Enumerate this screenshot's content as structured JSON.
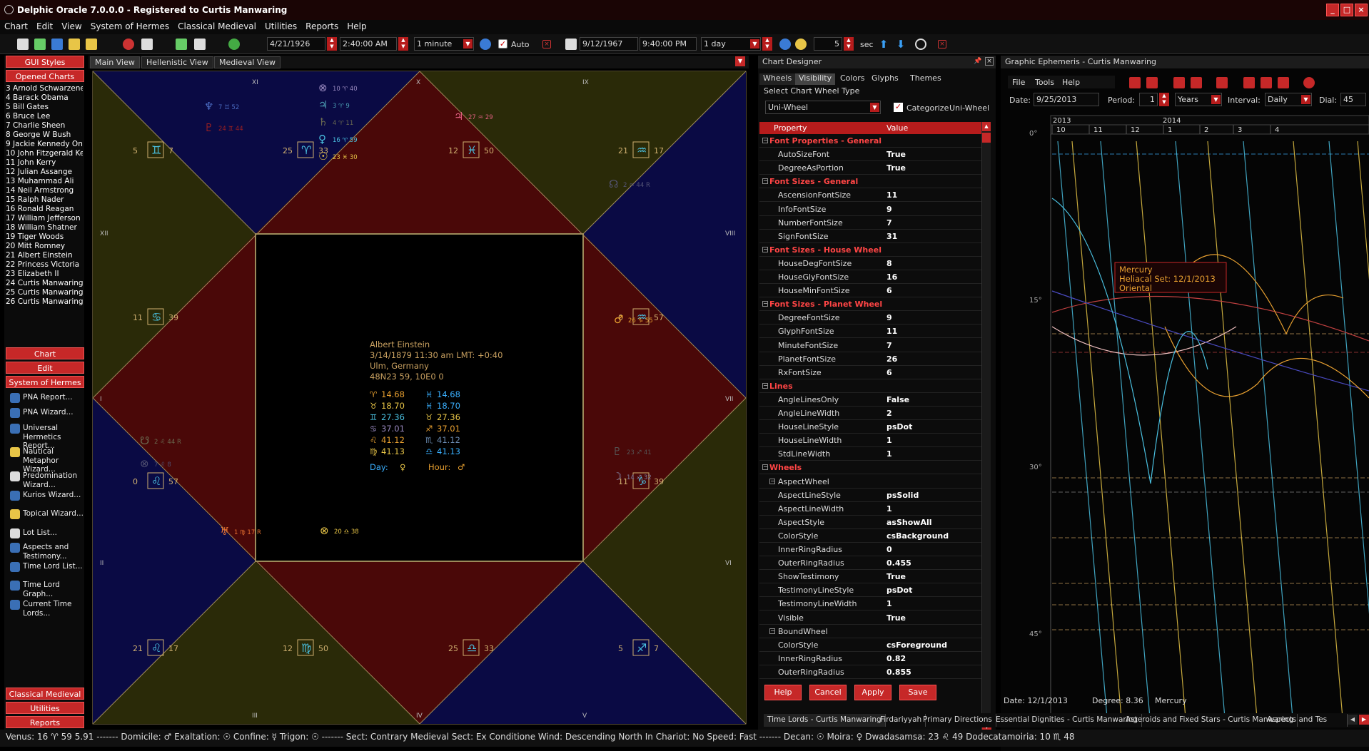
{
  "titlebar": {
    "title": "Delphic Oracle 7.0.0.0 -  Registered to Curtis Manwaring"
  },
  "menu": [
    "Chart",
    "Edit",
    "View",
    "System of Hermes",
    "Classical Medieval",
    "Utilities",
    "Reports",
    "Help"
  ],
  "toolbar": {
    "date1": "4/21/1926",
    "time1": "2:40:00 AM",
    "step1": "1 minute",
    "auto_label": "Auto",
    "date2": "9/12/1967",
    "time2": "9:40:00 PM",
    "step2": "1 day",
    "count": "5",
    "sec_label": "sec"
  },
  "left": {
    "gui_styles": "GUI Styles",
    "opened_charts": "Opened Charts",
    "charts": [
      "3 Arnold Schwarzeneg",
      "4 Barack Obama",
      "5 Bill Gates",
      "6 Bruce Lee",
      "7 Charlie Sheen",
      "8 George W Bush",
      "9 Jackie Kennedy Ona",
      "10 John Fitzgerald Ker",
      "11 John Kerry",
      "12 Julian Assange",
      "13 Muhammad Ali",
      "14 Neil Armstrong",
      "15 Ralph Nader",
      "16 Ronald Reagan",
      "17 William Jefferson C",
      "18 William Shatner",
      "19 Tiger Woods",
      "20 Mitt Romney",
      "21 Albert Einstein",
      "22 Princess Victoria",
      "23 Elizabeth II",
      "24 Curtis Manwaring",
      "25 Curtis Manwaring L",
      "26 Curtis Manwaring L"
    ],
    "sec_chart": "Chart",
    "sec_edit": "Edit",
    "sec_hermes": "System of Hermes",
    "wizards": [
      "PNA Report...",
      "PNA Wizard...",
      "Universal Hermetics Report...",
      "Nautical Metaphor Wizard...",
      "Predomination Wizard...",
      "Kurios Wizard...",
      "Topical Wizard...",
      "Lot List...",
      "Aspects and Testimony...",
      "Time Lord List...",
      "Time Lord Graph...",
      "Current Time Lords..."
    ],
    "classical": "Classical Medieval",
    "utilities": "Utilities",
    "reports": "Reports"
  },
  "view_tabs": [
    "Main View",
    "Hellenistic View",
    "Medieval View"
  ],
  "chart": {
    "center": {
      "name": "Albert Einstein",
      "dateline": "3/14/1879  11:30 am  LMT: +0:40",
      "place": "Ulm, Germany",
      "coords": "48N23 59,  10E0 0",
      "lots": [
        [
          "♈",
          "14.68",
          "♓",
          "14.68"
        ],
        [
          "♉",
          "18.70",
          "♓",
          "18.70"
        ],
        [
          "♊",
          "27.36",
          "♉",
          "27.36"
        ],
        [
          "♋",
          "37.01",
          "♐",
          "37.01"
        ],
        [
          "♌",
          "41.12",
          "♏",
          "41.12"
        ],
        [
          "♍",
          "41.13",
          "♎",
          "41.13"
        ]
      ],
      "day_label": "Day:",
      "day_val": "♀",
      "hour_label": "Hour:",
      "hour_val": "♂"
    },
    "roman": [
      "XI",
      "X",
      "IX",
      "XII",
      "VIII",
      "I",
      "VII",
      "II",
      "VI",
      "III",
      "IV",
      "V"
    ],
    "cusps": [
      [
        "5",
        "♊",
        "7"
      ],
      [
        "25",
        "♈",
        "33"
      ],
      [
        "12",
        "♓",
        "50"
      ],
      [
        "21",
        "♒",
        "17"
      ],
      [
        "11",
        "♋",
        "39"
      ],
      [
        "0",
        "♒",
        "57"
      ],
      [
        "0",
        "♌",
        "57"
      ],
      [
        "11",
        "♑",
        "39"
      ],
      [
        "21",
        "♌",
        "17"
      ],
      [
        "12",
        "♍",
        "50"
      ],
      [
        "25",
        "♎",
        "33"
      ],
      [
        "5",
        "♐",
        "7"
      ]
    ],
    "planets": [
      [
        "♆",
        "7 ♊ 52"
      ],
      [
        "♇",
        "24 ♊ 44"
      ],
      [
        "⊗",
        "10 ♈ 40"
      ],
      [
        "♃",
        "3 ♈ 9"
      ],
      [
        "♄",
        "4 ♈ 11"
      ],
      [
        "♀",
        "16 ♈ 59"
      ],
      [
        "☉",
        "23 ♓ 30"
      ],
      [
        "♃",
        "27 ♒ 29"
      ],
      [
        "☊",
        "2 ♒ 44 R"
      ],
      [
        "♂",
        "26 ♑ 55"
      ],
      [
        "☋",
        "2 ♌ 44 R"
      ],
      [
        "⊗",
        "7 ♌ 8"
      ],
      [
        "♅",
        "1 ♍ 17 R"
      ],
      [
        "⊗",
        "20 ♎ 38"
      ],
      [
        "♇",
        "23 ♐ 41"
      ],
      [
        "☽",
        "14 ♐ 32"
      ]
    ]
  },
  "designer": {
    "title": "Chart Designer",
    "tabs": [
      "Wheels",
      "Visibility",
      "Colors",
      "Glyphs",
      "Themes"
    ],
    "select_label": "Select Chart Wheel Type",
    "wheel_type": "Uni-Wheel",
    "categorize": "Categorize",
    "cat_value": "Uni-Wheel",
    "col_property": "Property",
    "col_value": "Value",
    "rows": [
      {
        "c": 1,
        "n": "Font Properties - General"
      },
      {
        "n": "AutoSizeFont",
        "v": "True"
      },
      {
        "n": "DegreeAsPortion",
        "v": "True"
      },
      {
        "c": 1,
        "n": "Font Sizes - General"
      },
      {
        "n": "AscensionFontSize",
        "v": "11"
      },
      {
        "n": "InfoFontSize",
        "v": "9"
      },
      {
        "n": "NumberFontSize",
        "v": "7"
      },
      {
        "n": "SignFontSize",
        "v": "31"
      },
      {
        "c": 1,
        "n": "Font Sizes - House Wheel"
      },
      {
        "n": "HouseDegFontSize",
        "v": "8"
      },
      {
        "n": "HouseGlyFontSize",
        "v": "16"
      },
      {
        "n": "HouseMinFontSize",
        "v": "6"
      },
      {
        "c": 1,
        "n": "Font Sizes - Planet Wheel"
      },
      {
        "n": "DegreeFontSize",
        "v": "9"
      },
      {
        "n": "GlyphFontSize",
        "v": "11"
      },
      {
        "n": "MinuteFontSize",
        "v": "7"
      },
      {
        "n": "PlanetFontSize",
        "v": "26"
      },
      {
        "n": "RxFontSize",
        "v": "6"
      },
      {
        "c": 1,
        "n": "Lines"
      },
      {
        "n": "AngleLinesOnly",
        "v": "False"
      },
      {
        "n": "AngleLineWidth",
        "v": "2"
      },
      {
        "n": "HouseLineStyle",
        "v": "psDot"
      },
      {
        "n": "HouseLineWidth",
        "v": "1"
      },
      {
        "n": "StdLineWidth",
        "v": "1"
      },
      {
        "c": 1,
        "n": "Wheels"
      },
      {
        "c": 2,
        "n": "AspectWheel"
      },
      {
        "n": "AspectLineStyle",
        "v": "psSolid"
      },
      {
        "n": "AspectLineWidth",
        "v": "1"
      },
      {
        "n": "AspectStyle",
        "v": "asShowAll"
      },
      {
        "n": "ColorStyle",
        "v": "csBackground"
      },
      {
        "n": "InnerRingRadius",
        "v": "0"
      },
      {
        "n": "OuterRingRadius",
        "v": "0.455"
      },
      {
        "n": "ShowTestimony",
        "v": "True"
      },
      {
        "n": "TestimonyLineStyle",
        "v": "psDot"
      },
      {
        "n": "TestimonyLineWidth",
        "v": "1"
      },
      {
        "n": "Visible",
        "v": "True"
      },
      {
        "c": 2,
        "n": "BoundWheel"
      },
      {
        "n": "ColorStyle",
        "v": "csForeground"
      },
      {
        "n": "InnerRingRadius",
        "v": "0.82"
      },
      {
        "n": "OuterRingRadius",
        "v": "0.855"
      }
    ],
    "buttons": [
      "Help",
      "Cancel",
      "Apply",
      "Save"
    ]
  },
  "ephem": {
    "title": "Graphic Ephemeris - Curtis Manwaring",
    "menu": [
      "File",
      "Tools",
      "Help"
    ],
    "date_label": "Date:",
    "date": "9/25/2013",
    "period_label": "Period:",
    "period": "1",
    "period_unit": "Years",
    "interval_label": "Interval:",
    "interval": "Daily",
    "dial_label": "Dial:",
    "dial": "45",
    "years": [
      "2013",
      "2014"
    ],
    "months": [
      "10",
      "11",
      "12",
      "1",
      "2",
      "3",
      "4"
    ],
    "yticks": [
      "0°",
      "15°",
      "30°",
      "45°"
    ],
    "tooltip": [
      "Mercury",
      "Heliacal Set: 12/1/2013",
      "Oriental"
    ],
    "status_date": "Date: 12/1/2013",
    "status_degree": "Degree: 8.36",
    "status_planet": "Mercury"
  },
  "bottom_tabs": [
    "Time Lords - Curtis Manwaring",
    "Firdariyyah",
    "Primary Directions",
    "Essential Dignities - Curtis Manwaring",
    "Asteroids and Fixed Stars - Curtis Manwaring",
    "Aspects and Tes"
  ],
  "status": "Venus: 16 ♈ 59 5.91 ------- Domicile: ♂ Exaltation: ☉ Confine: ☿ Trigon: ☉ ------- Sect: Contrary Medieval Sect: Ex Conditione Wind: Descending North In Chariot: No Speed: Fast ------- Decan: ☉ Moira: ♀ Dwadasamsa: 23 ♌ 49 Dodecatamoiria: 10 ♏ 48"
}
